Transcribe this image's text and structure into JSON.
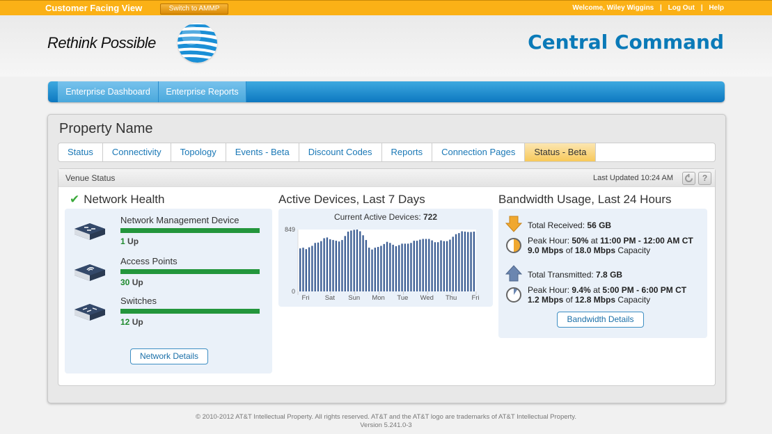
{
  "topbar": {
    "view_label": "Customer Facing View",
    "switch_button": "Switch to AMMP",
    "welcome": "Welcome, Wiley Wiggins",
    "separator": "|",
    "logout": "Log Out",
    "help": "Help"
  },
  "header": {
    "tagline": "Rethink Possible",
    "logo": "att-globe-logo",
    "title": "Central Command"
  },
  "nav": {
    "items": [
      {
        "label": "Enterprise Dashboard"
      },
      {
        "label": "Enterprise Reports"
      }
    ]
  },
  "property": {
    "name": "Property Name",
    "tabs": [
      {
        "label": "Status",
        "active": false
      },
      {
        "label": "Connectivity",
        "active": false
      },
      {
        "label": "Topology",
        "active": false
      },
      {
        "label": "Events - Beta",
        "active": false
      },
      {
        "label": "Discount Codes",
        "active": false
      },
      {
        "label": "Reports",
        "active": false
      },
      {
        "label": "Connection Pages",
        "active": false
      },
      {
        "label": "Status - Beta",
        "active": true
      }
    ]
  },
  "venue": {
    "title": "Venue Status",
    "last_updated": "Last Updated 10:24 AM",
    "refresh_icon": "refresh-icon",
    "help_icon": "help-icon",
    "help_glyph": "?"
  },
  "network_health": {
    "title": "Network Health",
    "status_icon": "check-icon",
    "devices": [
      {
        "name": "Network Management Device",
        "count": "1",
        "suffix": " Up",
        "up_fraction": 1.0,
        "icon": "network-device-icon"
      },
      {
        "name": "Access Points",
        "count": "30",
        "suffix": " Up",
        "up_fraction": 1.0,
        "icon": "access-point-icon"
      },
      {
        "name": "Switches",
        "count": "12",
        "suffix": " Up",
        "up_fraction": 1.0,
        "icon": "switch-icon"
      }
    ],
    "details_button": "Network Details"
  },
  "active_devices": {
    "title": "Active Devices, Last 7 Days",
    "current_label": "Current Active Devices: ",
    "current_value": "722"
  },
  "chart_data": {
    "type": "bar",
    "title": "Active Devices, Last 7 Days",
    "subtitle": "Current Active Devices: 722",
    "xlabel": "",
    "ylabel": "",
    "ylim": [
      0,
      849
    ],
    "y_ticks": [
      "0",
      "849"
    ],
    "x_tick_labels": [
      "Fri",
      "Sat",
      "Sun",
      "Mon",
      "Tue",
      "Wed",
      "Thu",
      "Fri"
    ],
    "grid": false,
    "values": [
      590,
      600,
      580,
      605,
      625,
      665,
      670,
      690,
      730,
      740,
      715,
      705,
      695,
      685,
      705,
      760,
      820,
      835,
      845,
      849,
      825,
      770,
      705,
      600,
      575,
      600,
      610,
      625,
      650,
      680,
      665,
      640,
      620,
      635,
      655,
      655,
      655,
      665,
      695,
      695,
      710,
      720,
      720,
      720,
      700,
      675,
      675,
      700,
      690,
      690,
      710,
      750,
      785,
      800,
      825,
      820,
      815,
      815,
      820
    ]
  },
  "bandwidth": {
    "title": "Bandwidth Usage, Last 24 Hours",
    "received": {
      "label": "Total Received: ",
      "value": "56 GB",
      "icon": "download-arrow-icon",
      "peak_label": "Peak Hour: ",
      "peak_percent": "50%",
      "peak_fraction": 0.5,
      "at": " at ",
      "peak_time": "11:00 PM - 12:00 AM CT",
      "rate": "9.0 Mbps",
      "of": " of ",
      "capacity": "18.0 Mbps",
      "capacity_label": " Capacity",
      "gauge_icon": "usage-gauge-icon"
    },
    "transmitted": {
      "label": "Total Transmitted: ",
      "value": "7.8 GB",
      "icon": "upload-arrow-icon",
      "peak_label": "Peak Hour: ",
      "peak_percent": "9.4%",
      "peak_fraction": 0.094,
      "at": " at ",
      "peak_time": "5:00 PM - 6:00 PM CT",
      "rate": "1.2 Mbps",
      "of": " of ",
      "capacity": "12.8 Mbps",
      "capacity_label": " Capacity",
      "gauge_icon": "usage-gauge-icon"
    },
    "details_button": "Bandwidth Details",
    "colors": {
      "received": "#f0a830",
      "transmitted": "#6b86b0"
    }
  },
  "footer": {
    "copyright": "© 2010-2012 AT&T Intellectual Property. All rights reserved. AT&T and the AT&T logo are trademarks of AT&T Intellectual Property.",
    "version": "Version 5.241.0-3"
  }
}
